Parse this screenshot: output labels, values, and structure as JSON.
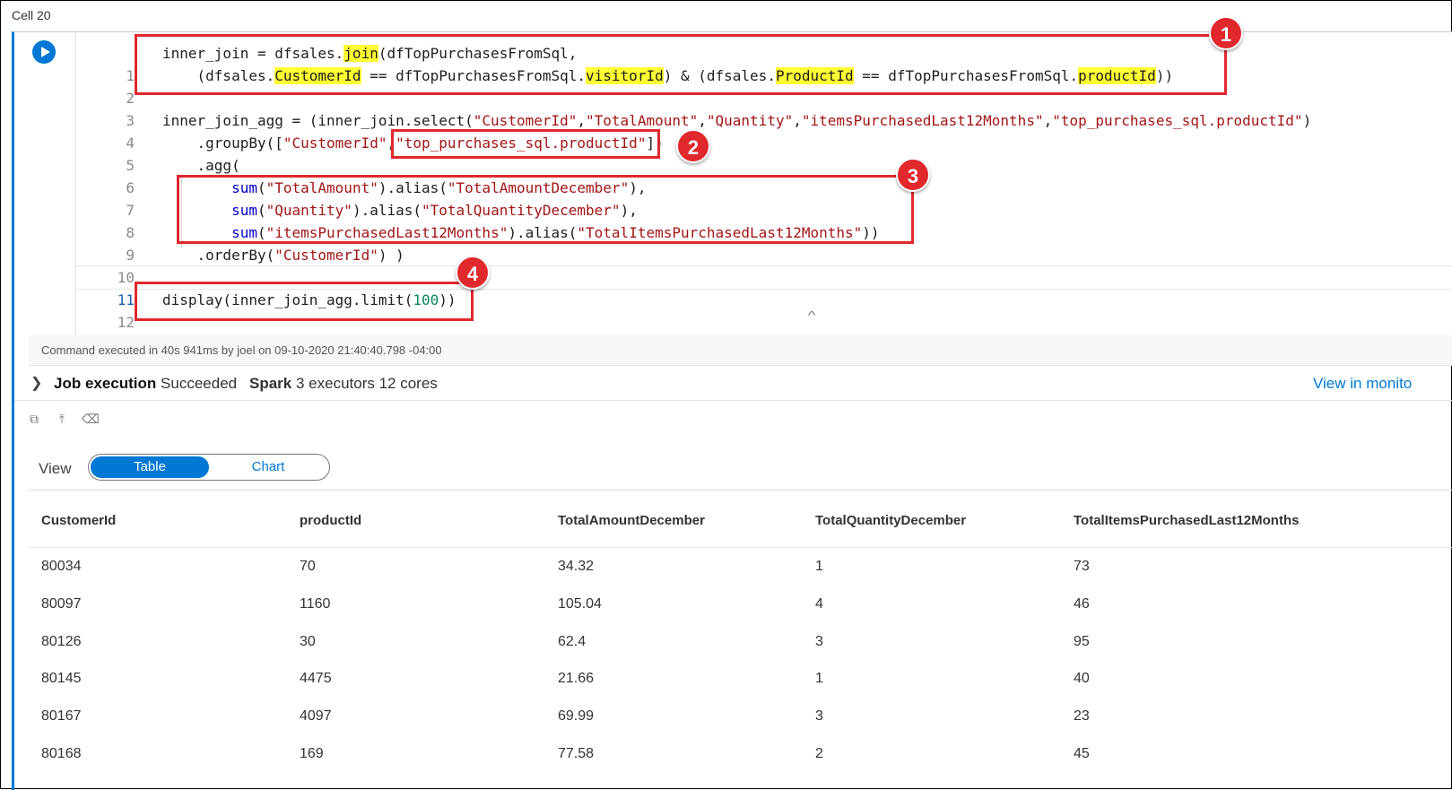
{
  "cell": {
    "label": "Cell 20"
  },
  "code": {
    "line_numbers": [
      "1",
      "2",
      "3",
      "4",
      "5",
      "6",
      "7",
      "8",
      "9",
      "10",
      "11",
      "12"
    ],
    "l1": {
      "a": "inner_join = dfsales.",
      "join": "join",
      "b": "(dfTopPurchasesFromSql,"
    },
    "l2": {
      "a": "    (dfsales.",
      "customerId": "CustomerId",
      "b": " == dfTopPurchasesFromSql.",
      "visitorId": "visitorId",
      "c": ") & (dfsales.",
      "productId": "ProductId",
      "d": " == dfTopPurchasesFromSql.",
      "productId2": "productId",
      "e": "))"
    },
    "l4": {
      "a": "inner_join_agg = (inner_join.select(",
      "s1": "\"CustomerId\"",
      "c1": ",",
      "s2": "\"TotalAmount\"",
      "c2": ",",
      "s3": "\"Quantity\"",
      "c3": ",",
      "s4": "\"itemsPurchasedLast12Months\"",
      "c4": ",",
      "s5": "\"top_purchases_sql.productId\"",
      "e": ")"
    },
    "l5": {
      "a": "    .groupBy([",
      "s1": "\"CustomerId\"",
      "c1": ",",
      "s2": "\"top_purchases_sql.productId\"",
      "e": "])"
    },
    "l6": {
      "a": "    .agg("
    },
    "l7": {
      "a": "        ",
      "fn": "sum",
      "b": "(",
      "s1": "\"TotalAmount\"",
      "c": ").alias(",
      "s2": "\"TotalAmountDecember\"",
      "e": "),"
    },
    "l8": {
      "a": "        ",
      "fn": "sum",
      "b": "(",
      "s1": "\"Quantity\"",
      "c": ").alias(",
      "s2": "\"TotalQuantityDecember\"",
      "e": "),"
    },
    "l9": {
      "a": "        ",
      "fn": "sum",
      "b": "(",
      "s1": "\"itemsPurchasedLast12Months\"",
      "c": ").alias(",
      "s2": "\"TotalItemsPurchasedLast12Months\"",
      "e": "))"
    },
    "l10": {
      "a": "    .orderBy(",
      "s1": "\"CustomerId\"",
      "e": ") )"
    },
    "l12": {
      "a": "display(inner_join_agg.limit(",
      "n": "100",
      "e": "))"
    }
  },
  "annotations": [
    "1",
    "2",
    "3",
    "4"
  ],
  "status": {
    "text": "Command executed in 40s 941ms by joel on 09-10-2020 21:40:40.798 -04:00"
  },
  "job": {
    "label": "Job execution",
    "state": "Succeeded",
    "spark_label": "Spark",
    "spark_detail": "3 executors 12 cores",
    "monitor_link": "View in monito"
  },
  "view": {
    "label": "View",
    "options": [
      "Table",
      "Chart"
    ],
    "selected": "Table"
  },
  "table": {
    "columns": [
      "CustomerId",
      "productId",
      "TotalAmountDecember",
      "TotalQuantityDecember",
      "TotalItemsPurchasedLast12Months"
    ],
    "rows": [
      [
        "80034",
        "70",
        "34.32",
        "1",
        "73"
      ],
      [
        "80097",
        "1160",
        "105.04",
        "4",
        "46"
      ],
      [
        "80126",
        "30",
        "62.4",
        "3",
        "95"
      ],
      [
        "80145",
        "4475",
        "21.66",
        "1",
        "40"
      ],
      [
        "80167",
        "4097",
        "69.99",
        "3",
        "23"
      ],
      [
        "80168",
        "169",
        "77.58",
        "2",
        "45"
      ]
    ]
  },
  "colors": {
    "accent": "#0078d4",
    "annotation": "#e0282d",
    "highlight": "#ffff33",
    "string": "#a31515"
  }
}
